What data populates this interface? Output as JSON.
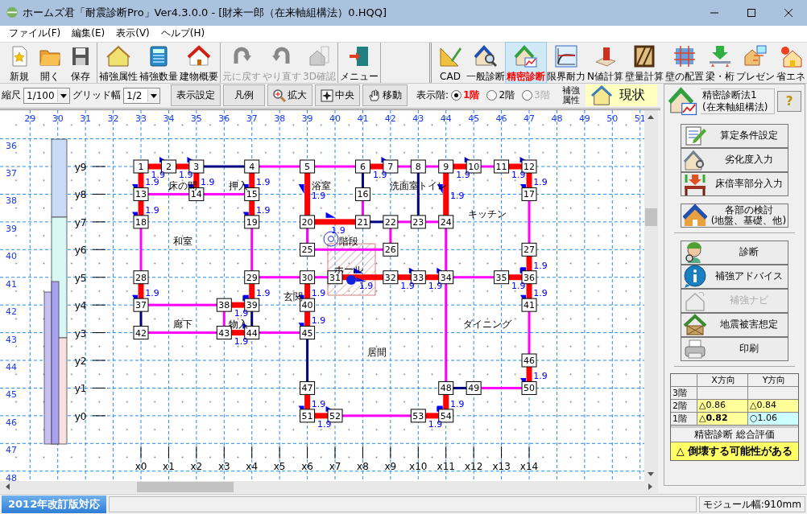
{
  "window": {
    "title": "ホームズ君「耐震診断Pro」Ver4.3.0.0 - [財来一郎（在来軸組構法）0.HQQ]"
  },
  "menu": [
    {
      "label": "ファイル(F)"
    },
    {
      "label": "編集(E)"
    },
    {
      "label": "表示(V)"
    },
    {
      "label": "ヘルプ(H)"
    }
  ],
  "toolbar": [
    {
      "items": [
        {
          "label": "新規",
          "selected": false,
          "disabled": false
        },
        {
          "label": "開く",
          "selected": false,
          "disabled": false
        },
        {
          "label": "保存",
          "selected": false,
          "disabled": false
        }
      ]
    },
    {
      "items": [
        {
          "label": "補強属性",
          "selected": false,
          "disabled": false
        },
        {
          "label": "補強数量",
          "selected": false,
          "disabled": false
        },
        {
          "label": "建物概要",
          "selected": false,
          "disabled": false
        }
      ]
    },
    {
      "items": [
        {
          "label": "元に戻す",
          "selected": false,
          "disabled": true
        },
        {
          "label": "やり直す",
          "selected": false,
          "disabled": true
        },
        {
          "label": "3D確認",
          "selected": false,
          "disabled": true
        }
      ]
    },
    {
      "items": [
        {
          "label": "メニュー",
          "selected": false,
          "disabled": false
        }
      ]
    },
    {
      "items": [
        {
          "label": "CAD",
          "selected": false,
          "disabled": false
        },
        {
          "label": "一般診断",
          "selected": false,
          "disabled": false
        },
        {
          "label": "精密診断",
          "selected": true,
          "disabled": false
        },
        {
          "label": "限界耐力",
          "selected": false,
          "disabled": false
        },
        {
          "label": "N値計算",
          "selected": false,
          "disabled": false
        },
        {
          "label": "壁量計算",
          "selected": false,
          "disabled": false
        },
        {
          "label": "壁の配置",
          "selected": false,
          "disabled": false
        },
        {
          "label": "梁・桁",
          "selected": false,
          "disabled": false
        },
        {
          "label": "プレゼン",
          "selected": false,
          "disabled": false
        },
        {
          "label": "省エネ",
          "selected": false,
          "disabled": false
        }
      ]
    }
  ],
  "view_bar": {
    "scale": {
      "label": "縮尺",
      "value": "1/100"
    },
    "grid": {
      "label": "グリッド幅",
      "value": "1/2"
    },
    "buttons": [
      {
        "label": "表示設定",
        "kind": "plain"
      },
      {
        "label": "凡例",
        "kind": "plain"
      },
      {
        "label": "拡大",
        "kind": "zoom"
      },
      {
        "label": "中央",
        "kind": "center"
      },
      {
        "label": "移動",
        "kind": "pan"
      }
    ],
    "floor_label": "表示階:",
    "floors": [
      {
        "label": "1階",
        "selected": true,
        "disabled": false
      },
      {
        "label": "2階",
        "selected": false,
        "disabled": false
      },
      {
        "label": "3階",
        "selected": false,
        "disabled": true
      }
    ],
    "attribute": {
      "label": "補強属性",
      "value": "現状"
    }
  },
  "plan": {
    "columns": [
      "29",
      "30",
      "31",
      "32",
      "33",
      "34",
      "35",
      "36",
      "37",
      "38",
      "39",
      "40",
      "41",
      "42",
      "43",
      "44",
      "45",
      "46",
      "47",
      "48",
      "49",
      "50",
      "51"
    ],
    "rows": [
      "36",
      "37",
      "38",
      "39",
      "40",
      "41",
      "42",
      "43",
      "44",
      "45",
      "46",
      "47",
      "48"
    ],
    "x_axes": [
      "x0",
      "x1",
      "x2",
      "x3",
      "x4",
      "x5",
      "x6",
      "x7",
      "x8",
      "x9",
      "x10",
      "x11",
      "x12",
      "x13",
      "x14"
    ],
    "grid": [
      {
        "label": "y9",
        "cells": [
          {
            "kind": "node",
            "label": "1",
            "right": {
              "kind": "bearing",
              "value": "1.9"
            },
            "down": {
              "kind": "bearing",
              "value": "1.9"
            }
          },
          {
            "kind": "node",
            "label": "2",
            "room": "床の間",
            "right": {
              "kind": "bearing",
              "value": "1.9"
            }
          },
          {
            "kind": "node",
            "label": "3",
            "right": {
              "kind": "opening"
            },
            "down": {
              "kind": "bearing",
              "value": "1.9"
            }
          },
          {
            "kind": "empty",
            "room": "押入"
          },
          {
            "kind": "node",
            "label": "4",
            "right": {
              "kind": "partition"
            },
            "down": {
              "kind": "bearing",
              "value": "1.9"
            }
          },
          {
            "kind": "empty"
          },
          {
            "kind": "node",
            "label": "5",
            "room": "浴室",
            "right": {
              "kind": "partition"
            },
            "down": {
              "kind": "bearing",
              "value": "1.9"
            }
          },
          {
            "kind": "empty"
          },
          {
            "kind": "node",
            "label": "6",
            "right": {
              "kind": "bearing",
              "value": "1.9"
            },
            "down": {
              "kind": "opening"
            }
          },
          {
            "kind": "node",
            "label": "7",
            "room": "洗面室",
            "right": {
              "kind": "partition"
            }
          },
          {
            "kind": "node",
            "label": "8",
            "room": "トイレ",
            "right": {
              "kind": "partition"
            },
            "down": {
              "kind": "opening"
            }
          },
          {
            "kind": "node",
            "label": "9",
            "right": {
              "kind": "bearing",
              "value": "1.9"
            },
            "down": {
              "kind": "bearing",
              "value": "1.9"
            }
          },
          {
            "kind": "node",
            "label": "10",
            "right": {
              "kind": "partition"
            }
          },
          {
            "kind": "node",
            "label": "11",
            "right": {
              "kind": "bearing",
              "value": "1.9"
            }
          },
          {
            "kind": "node",
            "label": "12",
            "down": {
              "kind": "bearing",
              "value": "1.9"
            }
          }
        ]
      },
      {
        "label": "y8",
        "cells": [
          {
            "kind": "node",
            "label": "13",
            "right": {
              "kind": "partition"
            },
            "down": {
              "kind": "bearing",
              "value": "1.9"
            }
          },
          {
            "kind": "empty"
          },
          {
            "kind": "node",
            "label": "14",
            "right": {
              "kind": "partition"
            }
          },
          {
            "kind": "empty"
          },
          {
            "kind": "node",
            "label": "15",
            "down": {
              "kind": "bearing",
              "value": "1.9"
            }
          },
          {
            "kind": "empty"
          },
          {
            "kind": "empty"
          },
          {
            "kind": "empty"
          },
          {
            "kind": "node",
            "label": "16",
            "down": {
              "kind": "partition"
            }
          },
          {
            "kind": "empty"
          },
          {
            "kind": "empty"
          },
          {
            "kind": "empty"
          },
          {
            "kind": "empty",
            "room": "キッチン"
          },
          {
            "kind": "empty"
          },
          {
            "kind": "node",
            "label": "17",
            "down": {
              "kind": "partition"
            }
          }
        ]
      },
      {
        "label": "y7",
        "cells": [
          {
            "kind": "node",
            "label": "18",
            "down": {
              "kind": "partition"
            }
          },
          {
            "kind": "empty",
            "room": "和室"
          },
          {
            "kind": "empty"
          },
          {
            "kind": "empty"
          },
          {
            "kind": "node",
            "label": "19",
            "down": {
              "kind": "partition"
            }
          },
          {
            "kind": "empty"
          },
          {
            "kind": "node",
            "label": "20",
            "right": {
              "kind": "bearing",
              "value": "1.9"
            },
            "down": {
              "kind": "partition"
            }
          },
          {
            "kind": "empty",
            "room": "階段"
          },
          {
            "kind": "node",
            "label": "21",
            "right": {
              "kind": "opening"
            }
          },
          {
            "kind": "node",
            "label": "22",
            "right": {
              "kind": "partition"
            },
            "down": {
              "kind": "partition"
            }
          },
          {
            "kind": "node",
            "label": "23",
            "right": {
              "kind": "partition"
            }
          },
          {
            "kind": "node",
            "label": "24",
            "down": {
              "kind": "partition"
            }
          },
          {
            "kind": "empty"
          },
          {
            "kind": "empty"
          },
          {
            "kind": "empty"
          }
        ]
      },
      {
        "label": "y6",
        "cells": [
          {
            "kind": "empty"
          },
          {
            "kind": "empty"
          },
          {
            "kind": "empty"
          },
          {
            "kind": "empty"
          },
          {
            "kind": "empty"
          },
          {
            "kind": "empty"
          },
          {
            "kind": "node",
            "label": "25",
            "right": {
              "kind": "partition"
            }
          },
          {
            "kind": "empty",
            "room": "ホール"
          },
          {
            "kind": "empty"
          },
          {
            "kind": "node",
            "label": "26"
          },
          {
            "kind": "empty"
          },
          {
            "kind": "empty"
          },
          {
            "kind": "empty"
          },
          {
            "kind": "empty"
          },
          {
            "kind": "node",
            "label": "27",
            "down": {
              "kind": "bearing",
              "value": "1.9"
            }
          }
        ]
      },
      {
        "label": "y5",
        "cells": [
          {
            "kind": "node",
            "label": "28",
            "down": {
              "kind": "bearing",
              "value": "1.9"
            }
          },
          {
            "kind": "empty"
          },
          {
            "kind": "empty"
          },
          {
            "kind": "empty"
          },
          {
            "kind": "node",
            "label": "29",
            "right": {
              "kind": "partition"
            },
            "down": {
              "kind": "bearing",
              "value": "1.9"
            }
          },
          {
            "kind": "empty",
            "room": "玄関"
          },
          {
            "kind": "node",
            "label": "30",
            "right": {
              "kind": "partition"
            },
            "down": {
              "kind": "bearing",
              "value": "1.9"
            }
          },
          {
            "kind": "node",
            "label": "31",
            "right": {
              "kind": "bearing",
              "value": "1.9"
            }
          },
          {
            "kind": "empty"
          },
          {
            "kind": "node",
            "label": "32",
            "right": {
              "kind": "bearing",
              "value": "1.9"
            }
          },
          {
            "kind": "node",
            "label": "33",
            "right": {
              "kind": "bearing",
              "value": "1.9"
            }
          },
          {
            "kind": "node",
            "label": "34",
            "right": {
              "kind": "partition"
            },
            "down": {
              "kind": "partition"
            }
          },
          {
            "kind": "empty"
          },
          {
            "kind": "node",
            "label": "35",
            "right": {
              "kind": "bearing",
              "value": "1.9"
            }
          },
          {
            "kind": "node",
            "label": "36",
            "down": {
              "kind": "bearing",
              "value": "1.9"
            }
          }
        ]
      },
      {
        "label": "y4",
        "cells": [
          {
            "kind": "node",
            "label": "37",
            "right": {
              "kind": "partition"
            },
            "down": {
              "kind": "opening"
            }
          },
          {
            "kind": "empty",
            "room": "廊下"
          },
          {
            "kind": "empty"
          },
          {
            "kind": "node",
            "label": "38",
            "room": "物入",
            "right": {
              "kind": "bearing",
              "value": "1.9"
            },
            "down": {
              "kind": "partition"
            }
          },
          {
            "kind": "node",
            "label": "39",
            "down": {
              "kind": "opening"
            }
          },
          {
            "kind": "empty"
          },
          {
            "kind": "node",
            "label": "40",
            "down": {
              "kind": "bearing",
              "value": "1.9"
            }
          },
          {
            "kind": "empty"
          },
          {
            "kind": "empty"
          },
          {
            "kind": "empty"
          },
          {
            "kind": "empty"
          },
          {
            "kind": "empty"
          },
          {
            "kind": "empty",
            "room": "ダイニング"
          },
          {
            "kind": "empty"
          },
          {
            "kind": "node",
            "label": "41",
            "down": {
              "kind": "partition"
            }
          }
        ]
      },
      {
        "label": "y3",
        "cells": [
          {
            "kind": "node",
            "label": "42",
            "right": {
              "kind": "partition"
            }
          },
          {
            "kind": "empty"
          },
          {
            "kind": "empty"
          },
          {
            "kind": "node",
            "label": "43",
            "right": {
              "kind": "bearing",
              "value": "1.9"
            }
          },
          {
            "kind": "node",
            "label": "44",
            "right": {
              "kind": "partition"
            }
          },
          {
            "kind": "empty"
          },
          {
            "kind": "node",
            "label": "45",
            "down": {
              "kind": "opening"
            }
          },
          {
            "kind": "empty"
          },
          {
            "kind": "empty",
            "room": "居間"
          },
          {
            "kind": "empty"
          },
          {
            "kind": "empty"
          },
          {
            "kind": "empty"
          },
          {
            "kind": "empty"
          },
          {
            "kind": "empty"
          },
          {
            "kind": "empty"
          }
        ]
      },
      {
        "label": "y2",
        "cells": [
          {
            "kind": "empty"
          },
          {
            "kind": "empty"
          },
          {
            "kind": "empty"
          },
          {
            "kind": "empty"
          },
          {
            "kind": "empty"
          },
          {
            "kind": "empty"
          },
          {
            "kind": "empty"
          },
          {
            "kind": "empty"
          },
          {
            "kind": "empty"
          },
          {
            "kind": "empty"
          },
          {
            "kind": "empty"
          },
          {
            "kind": "empty"
          },
          {
            "kind": "empty"
          },
          {
            "kind": "empty"
          },
          {
            "kind": "node",
            "label": "46",
            "down": {
              "kind": "bearing",
              "value": "1.9"
            }
          }
        ]
      },
      {
        "label": "y1",
        "cells": [
          {
            "kind": "empty"
          },
          {
            "kind": "empty"
          },
          {
            "kind": "empty"
          },
          {
            "kind": "empty"
          },
          {
            "kind": "empty"
          },
          {
            "kind": "empty"
          },
          {
            "kind": "node",
            "label": "47",
            "down": {
              "kind": "bearing",
              "value": "1.9"
            }
          },
          {
            "kind": "empty"
          },
          {
            "kind": "empty"
          },
          {
            "kind": "empty"
          },
          {
            "kind": "empty"
          },
          {
            "kind": "node",
            "label": "48",
            "right": {
              "kind": "opening"
            },
            "down": {
              "kind": "bearing",
              "value": "1.9"
            }
          },
          {
            "kind": "node",
            "label": "49",
            "right": {
              "kind": "partition"
            }
          },
          {
            "kind": "empty"
          },
          {
            "kind": "node",
            "label": "50"
          }
        ]
      },
      {
        "label": "y0",
        "cells": [
          {
            "kind": "empty"
          },
          {
            "kind": "empty"
          },
          {
            "kind": "empty"
          },
          {
            "kind": "empty"
          },
          {
            "kind": "empty"
          },
          {
            "kind": "empty"
          },
          {
            "kind": "node",
            "label": "51",
            "right": {
              "kind": "bearing",
              "value": "1.9"
            }
          },
          {
            "kind": "node",
            "label": "52",
            "right": {
              "kind": "partition"
            }
          },
          {
            "kind": "empty"
          },
          {
            "kind": "empty"
          },
          {
            "kind": "node",
            "label": "53",
            "right": {
              "kind": "bearing",
              "value": "1.9"
            }
          },
          {
            "kind": "node",
            "label": "54"
          },
          {
            "kind": "empty"
          },
          {
            "kind": "empty"
          },
          {
            "kind": "empty"
          }
        ]
      }
    ]
  },
  "side_panel": {
    "method": {
      "title": "精密診断法1",
      "subtitle": "(在来軸組構法)",
      "help": "?"
    },
    "sections": [
      {
        "buttons": [
          {
            "label": "算定条件設定",
            "disabled": false
          },
          {
            "label": "劣化度入力",
            "disabled": false
          },
          {
            "label": "床倍率部分入力",
            "disabled": false
          }
        ]
      },
      {
        "buttons": [
          {
            "label": "各部の検討\n(地盤、基礎、他)",
            "disabled": false
          }
        ]
      },
      {
        "buttons": [
          {
            "label": "診断",
            "disabled": false
          },
          {
            "label": "補強アドバイス",
            "disabled": false
          },
          {
            "label": "補強ナビ",
            "disabled": true
          },
          {
            "label": "地震被害想定",
            "disabled": false
          },
          {
            "label": "印刷",
            "disabled": false
          }
        ]
      }
    ],
    "results": {
      "columns": [
        "X方向",
        "Y方向"
      ],
      "rows": [
        {
          "floor": "3階"
        },
        {
          "floor": "2階",
          "cells": [
            {
              "text": "△0.86",
              "warning": true,
              "bold": false
            },
            {
              "text": "△0.84",
              "warning": true,
              "bold": false
            }
          ]
        },
        {
          "floor": "1階",
          "cells": [
            {
              "text": "△0.82",
              "warning": true,
              "bold": true
            },
            {
              "text": "○1.06",
              "warning": false,
              "bold": false
            }
          ]
        }
      ],
      "summary_title": "精密診断 総合評価",
      "verdict": "△ 倒壊する可能性がある",
      "verdict_warning": true
    }
  },
  "status_bar": {
    "edition": "2012年改訂版対応",
    "module": "モジュール幅:910mm"
  }
}
